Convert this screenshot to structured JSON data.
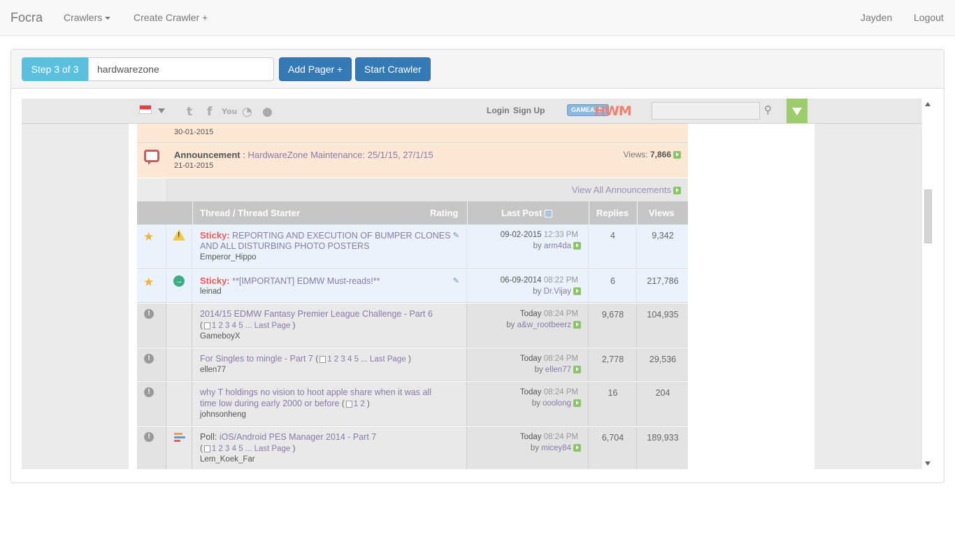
{
  "navbar": {
    "brand": "Focra",
    "crawlers": "Crawlers",
    "create": "Create Crawler +",
    "user": "Jayden",
    "logout": "Logout"
  },
  "toolbar": {
    "step": "Step 3 of 3",
    "crawler_name": "hardwarezone",
    "add_pager": "Add Pager +",
    "start_crawler": "Start Crawler"
  },
  "forum_header": {
    "login": "Login",
    "signup": "Sign Up",
    "gamea": "GAMEAXIS",
    "hwm": "HWM",
    "accent_color": "#9ccd6c"
  },
  "announcements": {
    "prev_date": "30-01-2015",
    "label": "Announcement",
    "sep": " : ",
    "title": "HardwareZone Maintenance: 25/1/15, 27/1/15",
    "views_label": "Views:",
    "views": "7,866",
    "date": "21-01-2015",
    "view_all": "View All Announcements"
  },
  "table_headers": {
    "thread": "Thread / Thread Starter",
    "rating": "Rating",
    "last_post": "Last Post",
    "replies": "Replies",
    "views": "Views"
  },
  "threads": [
    {
      "sticky_label": "Sticky:",
      "title1": "REPORTING AND EXECUTION OF BUMPER CLONES",
      "title2": "AND ALL DISTURBING PHOTO POSTERS",
      "starter": "Emperor_Hippo",
      "date": "09-02-2015",
      "time": "12:33 PM",
      "by": "by",
      "user": "arm4da",
      "replies": "4",
      "views": "9,342"
    },
    {
      "sticky_label": "Sticky:",
      "title1": "**[IMPORTANT] EDMW Must-reads!**",
      "starter": "leinad",
      "date": "06-09-2014",
      "time": "08:22 PM",
      "by": "by",
      "user": "Dr.Vijay",
      "replies": "6",
      "views": "217,786"
    },
    {
      "title1": "2014/15 EDMW Fantasy Premier League Challenge - Part 6",
      "pages": "1 2 3 4 5 ... Last Page",
      "starter": "GameboyX",
      "date": "Today",
      "time": "08:24 PM",
      "by": "by",
      "user": "a&w_rootbeerz",
      "replies": "9,678",
      "views": "104,935"
    },
    {
      "title1": "For Singles to mingle - Part 7",
      "pages": "1 2 3 4 5 ... Last Page",
      "starter": "ellen77",
      "date": "Today",
      "time": "08:24 PM",
      "by": "by",
      "user": "ellen77",
      "replies": "2,778",
      "views": "29,536"
    },
    {
      "title1": "why T holdings no vision to hoot apple share when it was all",
      "title2": "time low during early 2000 or before",
      "pages": "1 2",
      "starter": "johnsonheng",
      "date": "Today",
      "time": "08:24 PM",
      "by": "by",
      "user": "ooolong",
      "replies": "16",
      "views": "204"
    },
    {
      "poll_label": "Poll:",
      "title1": "iOS/Android PES Manager 2014 - Part 7",
      "pages": "1 2 3 4 5 ... Last Page",
      "starter": "Lem_Koek_Far",
      "date": "Today",
      "time": "08:24 PM",
      "by": "by",
      "user": "micey84",
      "replies": "6,704",
      "views": "189,933"
    }
  ]
}
